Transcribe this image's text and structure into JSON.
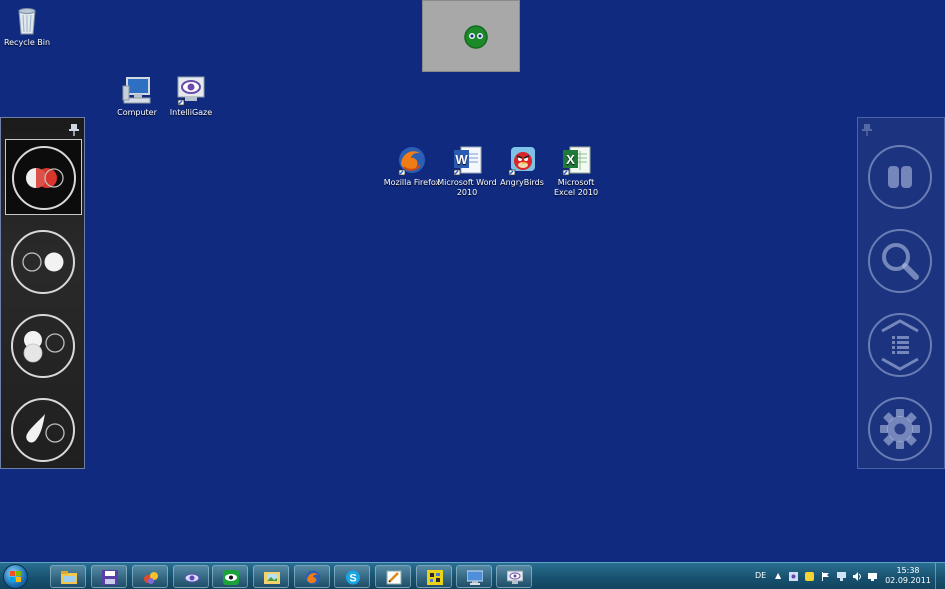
{
  "desktop": {
    "background_color": "#0f2a7f",
    "icons": [
      {
        "label": "Recycle Bin",
        "icon": "recycle-bin-icon"
      },
      {
        "label": "Computer",
        "icon": "computer-icon"
      },
      {
        "label": "IntelliGaze",
        "icon": "intelligaze-icon"
      },
      {
        "label": "Mozilla Firefox",
        "icon": "firefox-icon"
      },
      {
        "label": "Microsoft Word 2010",
        "icon": "word-icon"
      },
      {
        "label": "AngryBirds",
        "icon": "angry-birds-icon"
      },
      {
        "label": "Microsoft Excel 2010",
        "icon": "excel-icon"
      }
    ]
  },
  "left_panel": {
    "buttons": [
      {
        "name": "left-click-mode",
        "active": true
      },
      {
        "name": "double-click-mode",
        "active": false
      },
      {
        "name": "drag-mode",
        "active": false
      },
      {
        "name": "right-click-mode",
        "active": false
      }
    ]
  },
  "right_panel": {
    "buttons": [
      {
        "name": "pause",
        "icon": "pause-icon"
      },
      {
        "name": "magnify",
        "icon": "magnifier-icon"
      },
      {
        "name": "scroll",
        "icon": "scroll-icon"
      },
      {
        "name": "settings",
        "icon": "gear-icon"
      }
    ]
  },
  "taskbar": {
    "pinned": [
      "explorer-icon",
      "save-icon",
      "games-icon",
      "intelligaze-icon",
      "eye-tracker-icon",
      "folder-image-icon",
      "firefox-icon",
      "skype-icon",
      "editor-icon",
      "puzzle-icon",
      "remote-desktop-icon",
      "monitor-icon"
    ],
    "tray": {
      "language": "DE",
      "time": "15:38",
      "date": "02.09.2011"
    }
  }
}
